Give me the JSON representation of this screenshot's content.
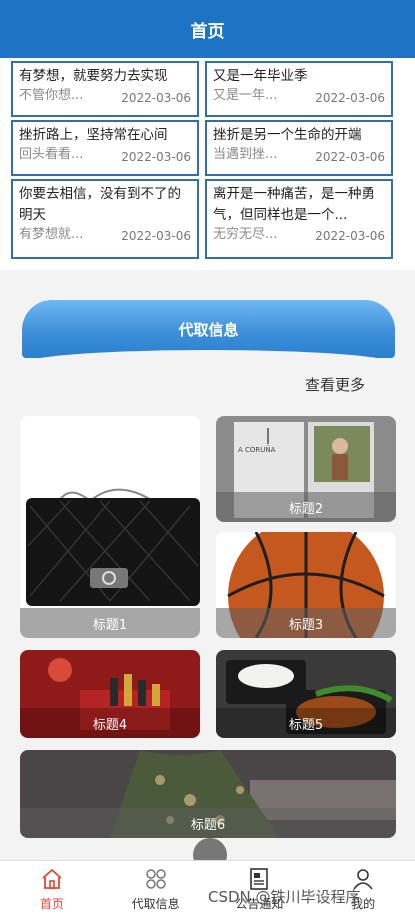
{
  "header": {
    "title": "首页"
  },
  "notices": [
    {
      "title": "有梦想，就要努力去实现",
      "preview": "不管你想...",
      "date": "2022-03-06"
    },
    {
      "title": "又是一年毕业季",
      "preview": "又是一年...",
      "date": "2022-03-06"
    },
    {
      "title": "挫折路上，坚持常在心间",
      "preview": "回头看看...",
      "date": "2022-03-06"
    },
    {
      "title": "挫折是另一个生命的开端",
      "preview": "当遇到挫...",
      "date": "2022-03-06"
    },
    {
      "title": "你要去相信，没有到不了的明天",
      "preview": "有梦想就...",
      "date": "2022-03-06"
    },
    {
      "title": "离开是一种痛苦，是一种勇气，但同样也是一个...",
      "preview": "无穷无尽...",
      "date": "2022-03-06"
    }
  ],
  "section": {
    "title": "代取信息",
    "more": "查看更多"
  },
  "cards": [
    {
      "label": "标题1",
      "image": "handbag-photo"
    },
    {
      "label": "标题2",
      "image": "magazine-photo"
    },
    {
      "label": "标题3",
      "image": "basketball-photo"
    },
    {
      "label": "标题4",
      "image": "cosmetics-photo"
    },
    {
      "label": "标题5",
      "image": "food-box-photo"
    },
    {
      "label": "标题6",
      "image": "dress-photo"
    }
  ],
  "tabbar": [
    {
      "label": "首页",
      "icon": "home-icon",
      "active": true
    },
    {
      "label": "代取信息",
      "icon": "grid-icon",
      "active": false
    },
    {
      "label": "公告通知",
      "icon": "notice-icon",
      "active": false
    },
    {
      "label": "我的",
      "icon": "user-icon",
      "active": false
    }
  ],
  "watermark": "CSDN @铁川毕设程序",
  "colors": {
    "primary": "#1e73c4",
    "active_tab": "#e0473a",
    "notice_border": "#356da8"
  }
}
